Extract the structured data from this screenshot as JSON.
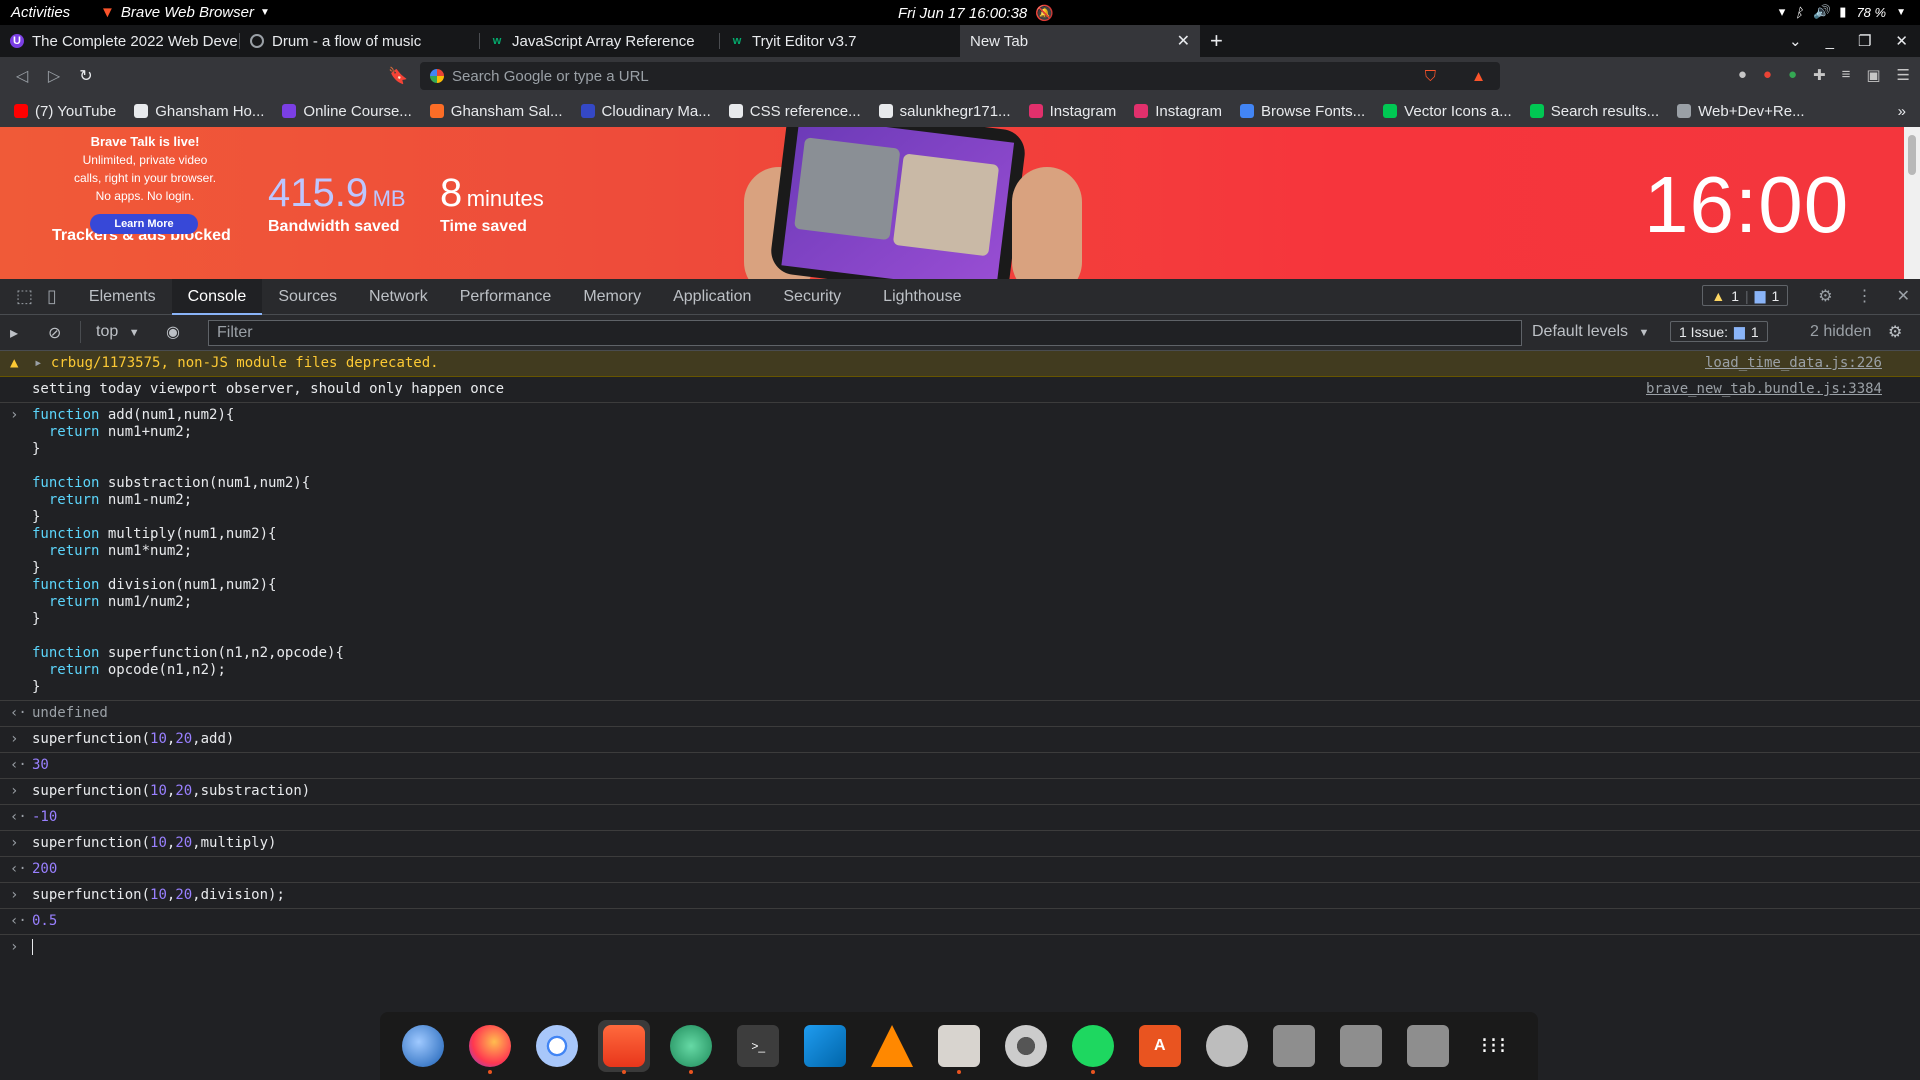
{
  "topbar": {
    "activities": "Activities",
    "app_name": "Brave Web Browser",
    "datetime": "Fri Jun 17  16:00:38",
    "battery": "78 %"
  },
  "tabs": [
    {
      "label": "The Complete 2022 Web Deve",
      "fav_color": "#7b3fe4"
    },
    {
      "label": "Drum - a flow of music",
      "fav_color": "#9aa0a6"
    },
    {
      "label": "JavaScript Array Reference",
      "fav_color": "#04aa6d"
    },
    {
      "label": "Tryit Editor v3.7",
      "fav_color": "#04aa6d"
    },
    {
      "label": "New Tab",
      "active": true
    }
  ],
  "omnibox": {
    "placeholder": "Search Google or type a URL"
  },
  "bookmarks": [
    {
      "label": "(7) YouTube",
      "color": "#ff0000"
    },
    {
      "label": "Ghansham Ho...",
      "color": "#e8eaed"
    },
    {
      "label": "Online Course...",
      "color": "#7b3fe4"
    },
    {
      "label": "Ghansham Sal...",
      "color": "#fc6d26"
    },
    {
      "label": "Cloudinary Ma...",
      "color": "#3448c5"
    },
    {
      "label": "CSS reference...",
      "color": "#e8eaed"
    },
    {
      "label": "salunkhegr171...",
      "color": "#e8eaed"
    },
    {
      "label": "Instagram",
      "color": "#e1306c"
    },
    {
      "label": "Instagram",
      "color": "#e1306c"
    },
    {
      "label": "Browse Fonts...",
      "color": "#4285f4"
    },
    {
      "label": "Vector Icons a...",
      "color": "#00c853"
    },
    {
      "label": "Search results...",
      "color": "#00c853"
    },
    {
      "label": "Web+Dev+Re...",
      "color": "#9aa0a6"
    }
  ],
  "hero": {
    "talk_title": "Brave Talk is live!",
    "talk_line1": "Unlimited, private video",
    "talk_line2": "calls, right in your browser.",
    "talk_line3": "No apps. No login.",
    "learn_more": "Learn More",
    "trackers_label": "Trackers & ads blocked",
    "bandwidth_value": "415.9",
    "bandwidth_unit": "MB",
    "bandwidth_label": "Bandwidth saved",
    "time_value": "8",
    "time_unit": "minutes",
    "time_label": "Time saved",
    "clock": "16:00"
  },
  "devtools": {
    "tabs": [
      "Elements",
      "Console",
      "Sources",
      "Network",
      "Performance",
      "Memory",
      "Application",
      "Security",
      "Lighthouse"
    ],
    "active_tab": "Console",
    "warn_count": "1",
    "msg_count": "1",
    "context": "top",
    "filter_placeholder": "Filter",
    "levels": "Default levels",
    "issues_label": "1 Issue:",
    "issues_count": "1",
    "hidden": "2 hidden"
  },
  "console": {
    "warning_text": "crbug/1173575, non-JS module files deprecated.",
    "warning_src": "load_time_data.js:226",
    "log_text": "setting today viewport observer, should only happen once",
    "log_src": "brave_new_tab.bundle.js:3384",
    "undefined_text": "undefined",
    "commands": [
      {
        "name": "superfunction",
        "a": "10",
        "b": "20",
        "op": "add",
        "tail": "",
        "result": "30"
      },
      {
        "name": "superfunction",
        "a": "10",
        "b": "20",
        "op": "substraction",
        "tail": "",
        "result": "-10"
      },
      {
        "name": "superfunction",
        "a": "10",
        "b": "20",
        "op": "multiply",
        "tail": "",
        "result": "200"
      },
      {
        "name": "superfunction",
        "a": "10",
        "b": "20",
        "op": "division",
        "tail": ";",
        "result": "0.5"
      }
    ]
  },
  "dock": [
    "thunderbird",
    "firefox",
    "chromium",
    "brave",
    "atom",
    "terminal",
    "vscode",
    "vlc",
    "files",
    "settings",
    "spotify",
    "app-center",
    "disk-utility",
    "disk-a",
    "disk-b",
    "disk-c",
    "show-apps"
  ]
}
